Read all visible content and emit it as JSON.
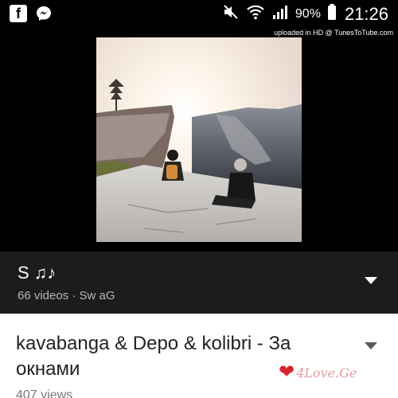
{
  "status_bar": {
    "left_icons": [
      "facebook-icon",
      "messenger-icon"
    ],
    "right_icons": [
      "mute-icon",
      "wifi-icon",
      "signal-icon"
    ],
    "battery": "90%",
    "time": "21:26"
  },
  "watermark": "uploaded in HD @ TunesToTube.com",
  "playlist": {
    "title": "S ♫♪",
    "meta": "66 videos · Sw aG"
  },
  "video": {
    "title": "kavabanga & Depo & kolibri - За окнами",
    "views": "407 views"
  },
  "logo": {
    "text": "4Love.Ge"
  },
  "colors": {
    "playlist_bg": "#1c1c1a",
    "heart": "#d8262f"
  }
}
